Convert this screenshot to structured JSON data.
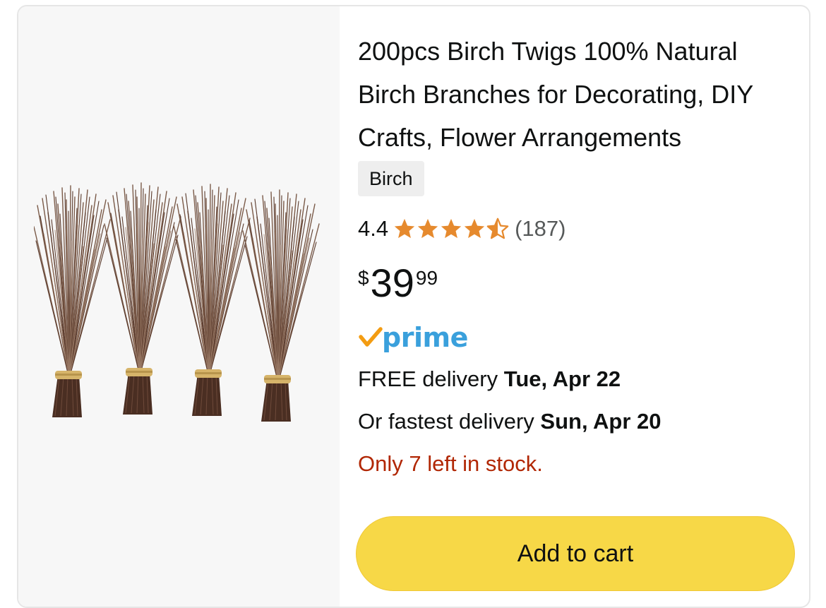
{
  "product": {
    "title": "200pcs Birch Twigs 100% Natural Birch Branches for Decorating, DIY Crafts, Flower Arrangements",
    "brand": "Birch",
    "rating": {
      "value": "4.4",
      "stars": 4.4,
      "count_text": "(187)"
    },
    "price": {
      "symbol": "$",
      "whole": "39",
      "fraction": "99"
    },
    "prime_label": "prime",
    "delivery": {
      "free_prefix": "FREE delivery ",
      "free_date": "Tue, Apr 22",
      "fast_prefix": "Or fastest delivery ",
      "fast_date": "Sun, Apr 20"
    },
    "stock_text": "Only 7 left in stock.",
    "add_to_cart_label": "Add to cart",
    "image_icon": "birch-twig-bundles-image"
  },
  "colors": {
    "star": "#e68a2e",
    "prime_blue": "#3aa0dc",
    "prime_check": "#f39c12",
    "stock_red": "#b12704",
    "button_yellow": "#f7d847"
  }
}
